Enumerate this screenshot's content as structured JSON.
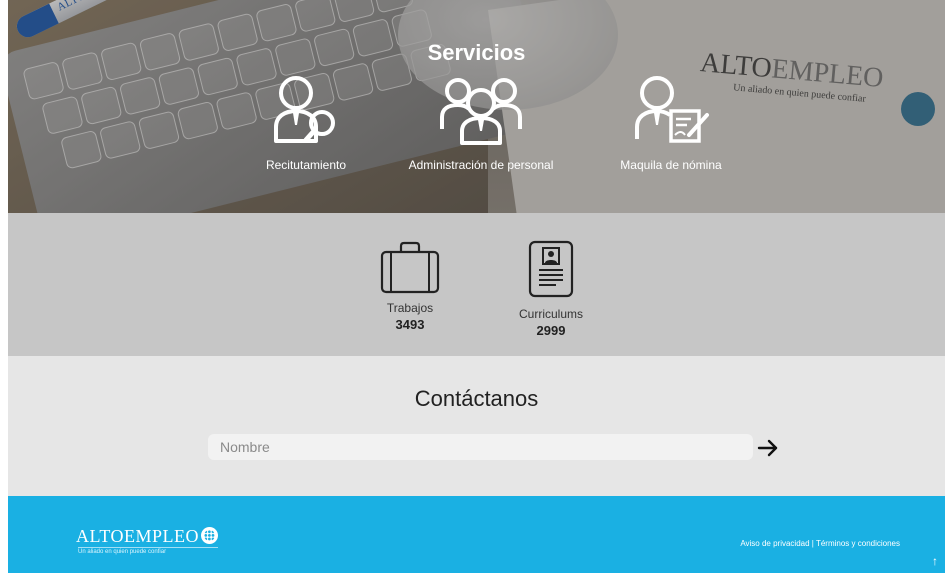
{
  "hero": {
    "title": "Servicios",
    "pen_brand": "ALTOEMPLEO",
    "paper_logo_dark": "ALTO",
    "paper_logo_light": "EMPLEO",
    "paper_tagline": "Un aliado en quien puede confiar",
    "services": [
      {
        "label": "Recitutamiento",
        "icon": "recruitment-icon"
      },
      {
        "label": "Administración de personal",
        "icon": "people-admin-icon"
      },
      {
        "label": "Maquila de nómina",
        "icon": "payroll-icon"
      }
    ]
  },
  "stats": {
    "jobs": {
      "label": "Trabajos",
      "count": "3493",
      "icon": "briefcase-icon"
    },
    "resumes": {
      "label": "Curriculums",
      "count": "2999",
      "icon": "resume-icon"
    }
  },
  "contact": {
    "title": "Contáctanos",
    "name_placeholder": "Nombre",
    "submit_icon": "arrow-right-icon"
  },
  "footer": {
    "logo": "ALTOEMPLEO",
    "tagline": "Un aliado en quien puede confiar",
    "privacy": "Aviso de privacidad",
    "separator": "|",
    "terms": "Términos y condiciones",
    "scroll_top": "↑"
  },
  "colors": {
    "footer_bg": "#1ab0e3",
    "stats_bg": "#c6c6c6",
    "contact_bg": "#e6e6e6"
  }
}
